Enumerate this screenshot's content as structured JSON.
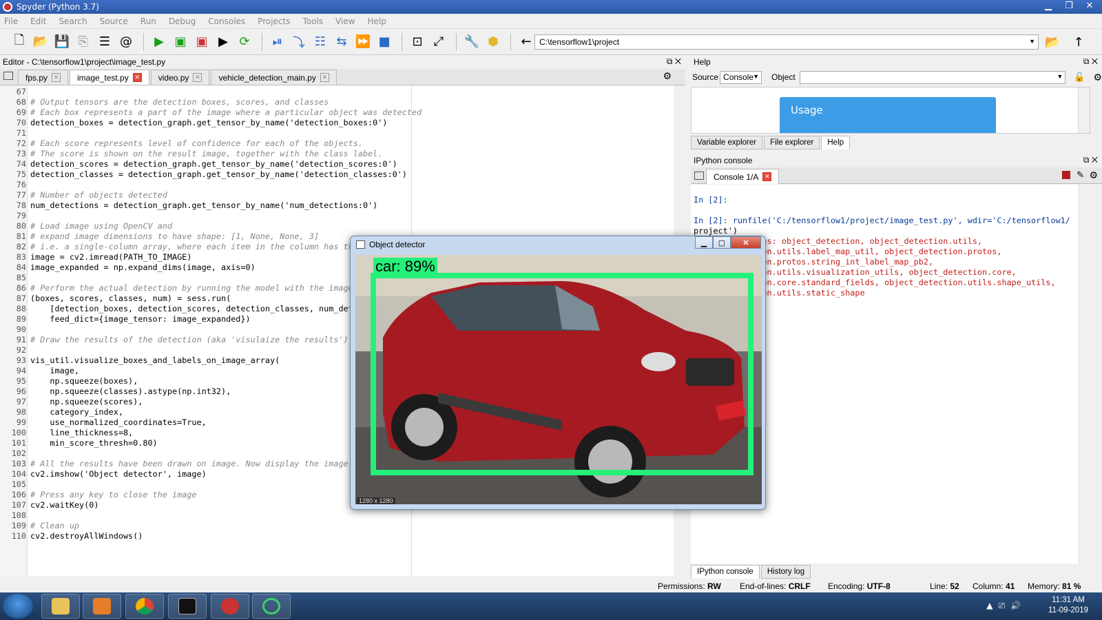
{
  "window": {
    "title": "Spyder (Python 3.7)"
  },
  "menu": [
    "File",
    "Edit",
    "Search",
    "Source",
    "Run",
    "Debug",
    "Consoles",
    "Projects",
    "Tools",
    "View",
    "Help"
  ],
  "toolbar": {
    "path": "C:\\tensorflow1\\project"
  },
  "editor": {
    "header": "Editor - C:\\tensorflow1\\project\\image_test.py",
    "tabs": [
      "fps.py",
      "image_test.py",
      "video.py",
      "vehicle_detection_main.py"
    ],
    "active_tab": 1,
    "lines": [
      {
        "n": "67",
        "t": ""
      },
      {
        "n": "68",
        "t": "# Output tensors are the detection boxes, scores, and classes",
        "c": "com"
      },
      {
        "n": "69",
        "t": "# Each box represents a part of the image where a particular object was detected",
        "c": "com"
      },
      {
        "n": "70",
        "t": "detection_boxes = detection_graph.get_tensor_by_name('detection_boxes:0')"
      },
      {
        "n": "71",
        "t": ""
      },
      {
        "n": "72",
        "t": "# Each score represents level of confidence for each of the objects.",
        "c": "com"
      },
      {
        "n": "73",
        "t": "# The score is shown on the result image, together with the class label.",
        "c": "com"
      },
      {
        "n": "74",
        "t": "detection_scores = detection_graph.get_tensor_by_name('detection_scores:0')"
      },
      {
        "n": "75",
        "t": "detection_classes = detection_graph.get_tensor_by_name('detection_classes:0')"
      },
      {
        "n": "76",
        "t": ""
      },
      {
        "n": "77",
        "t": "# Number of objects detected",
        "c": "com"
      },
      {
        "n": "78",
        "t": "num_detections = detection_graph.get_tensor_by_name('num_detections:0')"
      },
      {
        "n": "79",
        "t": ""
      },
      {
        "n": "80",
        "t": "# Load image using OpenCV and",
        "c": "com"
      },
      {
        "n": "81",
        "t": "# expand image dimensions to have shape: [1, None, None, 3]",
        "c": "com"
      },
      {
        "n": "82",
        "t": "# i.e. a single-column array, where each item in the column has th",
        "c": "com"
      },
      {
        "n": "83",
        "t": "image = cv2.imread(PATH_TO_IMAGE)"
      },
      {
        "n": "84",
        "t": "image_expanded = np.expand_dims(image, axis=0)"
      },
      {
        "n": "85",
        "t": ""
      },
      {
        "n": "86",
        "t": "# Perform the actual detection by running the model with the image",
        "c": "com"
      },
      {
        "n": "87",
        "t": "(boxes, scores, classes, num) = sess.run("
      },
      {
        "n": "88",
        "t": "    [detection_boxes, detection_scores, detection_classes, num_det"
      },
      {
        "n": "89",
        "t": "    feed_dict={image_tensor: image_expanded})"
      },
      {
        "n": "90",
        "t": ""
      },
      {
        "n": "91",
        "t": "# Draw the results of the detection (aka 'visulaize the results')",
        "c": "com"
      },
      {
        "n": "92",
        "t": ""
      },
      {
        "n": "93",
        "t": "vis_util.visualize_boxes_and_labels_on_image_array("
      },
      {
        "n": "94",
        "t": "    image,"
      },
      {
        "n": "95",
        "t": "    np.squeeze(boxes),"
      },
      {
        "n": "96",
        "t": "    np.squeeze(classes).astype(np.int32),"
      },
      {
        "n": "97",
        "t": "    np.squeeze(scores),"
      },
      {
        "n": "98",
        "t": "    category_index,"
      },
      {
        "n": "99",
        "t": "    use_normalized_coordinates=True,"
      },
      {
        "n": "100",
        "t": "    line_thickness=8,"
      },
      {
        "n": "101",
        "t": "    min_score_thresh=0.80)"
      },
      {
        "n": "102",
        "t": ""
      },
      {
        "n": "103",
        "t": "# All the results have been drawn on image. Now display the image.",
        "c": "com"
      },
      {
        "n": "104",
        "t": "cv2.imshow('Object detector', image)"
      },
      {
        "n": "105",
        "t": ""
      },
      {
        "n": "106",
        "t": "# Press any key to close the image",
        "c": "com"
      },
      {
        "n": "107",
        "t": "cv2.waitKey(0)"
      },
      {
        "n": "108",
        "t": ""
      },
      {
        "n": "109",
        "t": "# Clean up",
        "c": "com"
      },
      {
        "n": "110",
        "t": "cv2.destroyAllWindows()"
      }
    ]
  },
  "help": {
    "header": "Help",
    "source_label": "Source",
    "source_value": "Console",
    "object_label": "Object",
    "usage_title": "Usage",
    "tabs": [
      "Variable explorer",
      "File explorer",
      "Help"
    ],
    "active_tab": 2
  },
  "ipython": {
    "header": "IPython console",
    "tab": "Console 1/A",
    "lines": [
      {
        "t": "",
        "c": ""
      },
      {
        "t": "In [2]:",
        "c": "prompt"
      },
      {
        "t": "",
        "c": ""
      },
      {
        "t": "In [2]: runfile('C:/tensorflow1/project/image_test.py', wdir='C:/tensorflow1/",
        "c": "prompt"
      },
      {
        "t": "project')",
        "c": ""
      },
      {
        "t": "Reloaded modules: object_detection, object_detection.utils,",
        "c": "err"
      },
      {
        "t": "object_detection.utils.label_map_util, object_detection.protos,",
        "c": "err"
      },
      {
        "t": "object_detection.protos.string_int_label_map_pb2,",
        "c": "err"
      },
      {
        "t": "object_detection.utils.visualization_utils, object_detection.core,",
        "c": "err"
      },
      {
        "t": "object_detection.core.standard_fields, object_detection.utils.shape_utils,",
        "c": "err"
      },
      {
        "t": "object_detection.utils.static_shape",
        "c": "err"
      }
    ],
    "bottom_tabs": [
      "IPython console",
      "History log"
    ],
    "active_bottom_tab": 0
  },
  "status": {
    "permissions_label": "Permissions:",
    "permissions": "RW",
    "eol_label": "End-of-lines:",
    "eol": "CRLF",
    "encoding_label": "Encoding:",
    "encoding": "UTF-8",
    "line_label": "Line:",
    "line": "52",
    "column_label": "Column:",
    "column": "41",
    "memory_label": "Memory:",
    "memory": "81 %"
  },
  "detector": {
    "title": "Object detector",
    "label": "car: 89%",
    "size_text": "1280 x 1280",
    "box_color": "#25f07a"
  },
  "taskbar": {
    "time": "11:31 AM",
    "date": "11-09-2019"
  }
}
